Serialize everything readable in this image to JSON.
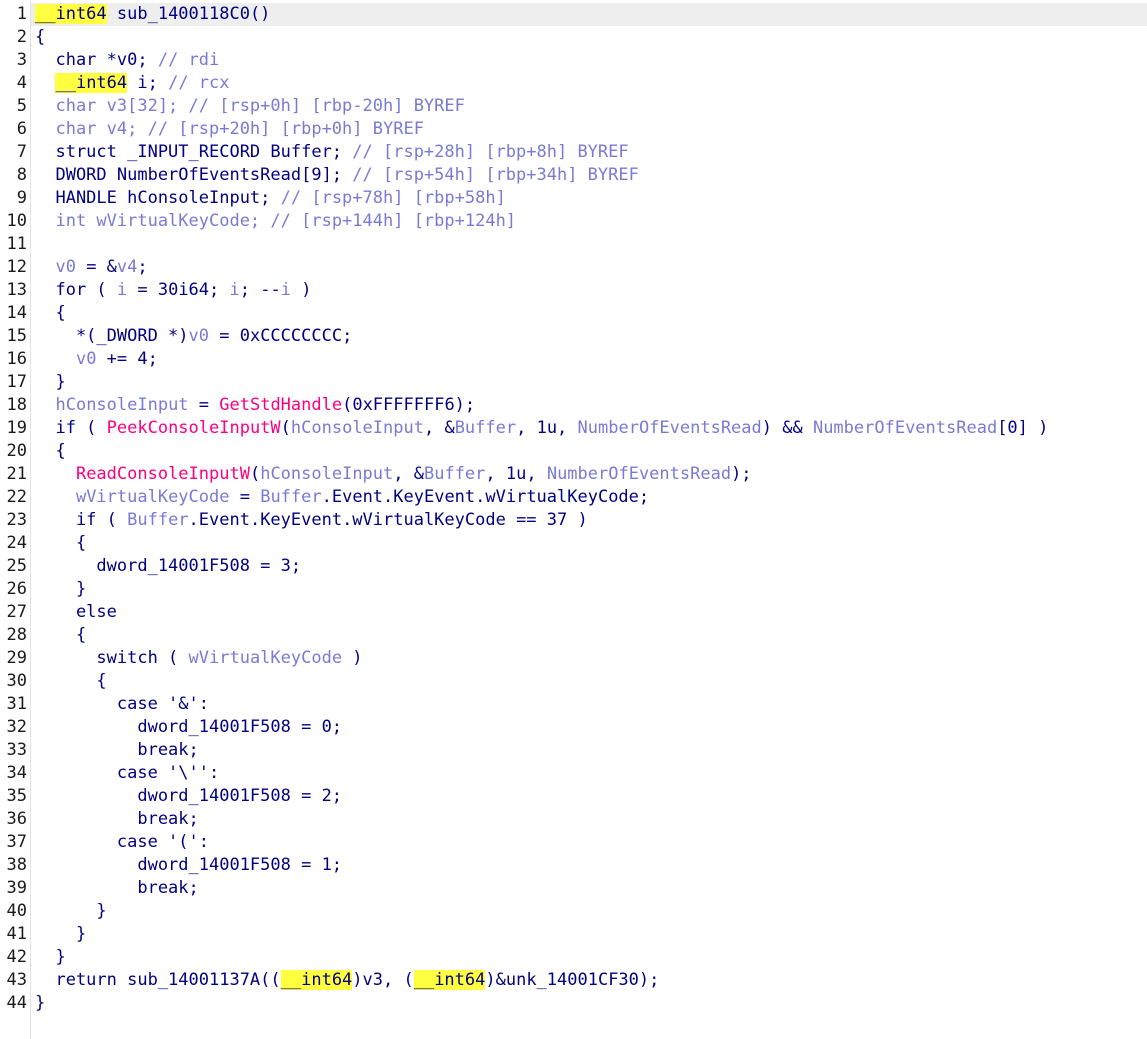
{
  "editor": {
    "lines": [
      {
        "num": "1",
        "tokens": [
          {
            "t": "__int64",
            "c": "hl"
          },
          {
            "t": " sub_1400118C0()",
            "c": "kw"
          }
        ]
      },
      {
        "num": "2",
        "tokens": [
          {
            "t": "{",
            "c": "kw"
          }
        ]
      },
      {
        "num": "3",
        "tokens": [
          {
            "t": "  char *v0; ",
            "c": "kw"
          },
          {
            "t": "// rdi",
            "c": "cmt"
          }
        ]
      },
      {
        "num": "4",
        "tokens": [
          {
            "t": "  ",
            "c": "kw"
          },
          {
            "t": "__int64",
            "c": "hl"
          },
          {
            "t": " i; ",
            "c": "kw"
          },
          {
            "t": "// rcx",
            "c": "cmt"
          }
        ]
      },
      {
        "num": "5",
        "tokens": [
          {
            "t": "  char v3[32]; // [rsp+0h] [rbp-20h] BYREF",
            "c": "cmt"
          }
        ]
      },
      {
        "num": "6",
        "tokens": [
          {
            "t": "  char v4; // [rsp+20h] [rbp+0h] BYREF",
            "c": "cmt"
          }
        ]
      },
      {
        "num": "7",
        "tokens": [
          {
            "t": "  struct _INPUT_RECORD Buffer; ",
            "c": "kw"
          },
          {
            "t": "// [rsp+28h] [rbp+8h] BYREF",
            "c": "cmt"
          }
        ]
      },
      {
        "num": "8",
        "tokens": [
          {
            "t": "  DWORD NumberOfEventsRead[9]; ",
            "c": "kw"
          },
          {
            "t": "// [rsp+54h] [rbp+34h] BYREF",
            "c": "cmt"
          }
        ]
      },
      {
        "num": "9",
        "tokens": [
          {
            "t": "  HANDLE hConsoleInput; ",
            "c": "kw"
          },
          {
            "t": "// [rsp+78h] [rbp+58h]",
            "c": "cmt"
          }
        ]
      },
      {
        "num": "10",
        "tokens": [
          {
            "t": "  int wVirtualKeyCode; // ",
            "c": "cmt"
          },
          {
            "t": "[rsp+144h] [rbp+124h]",
            "c": "cmt"
          }
        ]
      },
      {
        "num": "11",
        "tokens": []
      },
      {
        "num": "12",
        "tokens": [
          {
            "t": "  ",
            "c": "kw"
          },
          {
            "t": "v0",
            "c": "var"
          },
          {
            "t": " = &",
            "c": "kw"
          },
          {
            "t": "v4",
            "c": "var"
          },
          {
            "t": ";",
            "c": "kw"
          }
        ]
      },
      {
        "num": "13",
        "tokens": [
          {
            "t": "  for ( ",
            "c": "kw"
          },
          {
            "t": "i",
            "c": "var"
          },
          {
            "t": " = 30i64; ",
            "c": "kw"
          },
          {
            "t": "i",
            "c": "var"
          },
          {
            "t": "; --",
            "c": "kw"
          },
          {
            "t": "i",
            "c": "var"
          },
          {
            "t": " )",
            "c": "kw"
          }
        ]
      },
      {
        "num": "14",
        "tokens": [
          {
            "t": "  {",
            "c": "kw"
          }
        ]
      },
      {
        "num": "15",
        "tokens": [
          {
            "t": "    *(_DWORD *)",
            "c": "kw"
          },
          {
            "t": "v0",
            "c": "var"
          },
          {
            "t": " = 0xCCCCCCCC;",
            "c": "kw"
          }
        ]
      },
      {
        "num": "16",
        "tokens": [
          {
            "t": "    ",
            "c": "kw"
          },
          {
            "t": "v0",
            "c": "var"
          },
          {
            "t": " += 4;",
            "c": "kw"
          }
        ]
      },
      {
        "num": "17",
        "tokens": [
          {
            "t": "  }",
            "c": "kw"
          }
        ]
      },
      {
        "num": "18",
        "tokens": [
          {
            "t": "  ",
            "c": "kw"
          },
          {
            "t": "hConsoleInput",
            "c": "var"
          },
          {
            "t": " = ",
            "c": "kw"
          },
          {
            "t": "GetStdHandle",
            "c": "fn"
          },
          {
            "t": "(0xFFFFFFF6);",
            "c": "kw"
          }
        ]
      },
      {
        "num": "19",
        "tokens": [
          {
            "t": "  if ( ",
            "c": "kw"
          },
          {
            "t": "PeekConsoleInputW",
            "c": "fn"
          },
          {
            "t": "(",
            "c": "kw"
          },
          {
            "t": "hConsoleInput",
            "c": "var"
          },
          {
            "t": ", &",
            "c": "kw"
          },
          {
            "t": "Buffer",
            "c": "var"
          },
          {
            "t": ", 1u, ",
            "c": "kw"
          },
          {
            "t": "NumberOfEventsRead",
            "c": "var"
          },
          {
            "t": ") && ",
            "c": "kw"
          },
          {
            "t": "NumberOfEventsRead",
            "c": "var"
          },
          {
            "t": "[0] )",
            "c": "kw"
          }
        ]
      },
      {
        "num": "20",
        "tokens": [
          {
            "t": "  {",
            "c": "kw"
          }
        ]
      },
      {
        "num": "21",
        "tokens": [
          {
            "t": "    ",
            "c": "kw"
          },
          {
            "t": "ReadConsoleInputW",
            "c": "fn"
          },
          {
            "t": "(",
            "c": "kw"
          },
          {
            "t": "hConsoleInput",
            "c": "var"
          },
          {
            "t": ", &",
            "c": "kw"
          },
          {
            "t": "Buffer",
            "c": "var"
          },
          {
            "t": ", 1u, ",
            "c": "kw"
          },
          {
            "t": "NumberOfEventsRead",
            "c": "var"
          },
          {
            "t": ");",
            "c": "kw"
          }
        ]
      },
      {
        "num": "22",
        "tokens": [
          {
            "t": "    ",
            "c": "kw"
          },
          {
            "t": "wVirtualKeyCode",
            "c": "var"
          },
          {
            "t": " = ",
            "c": "kw"
          },
          {
            "t": "Buffer",
            "c": "var"
          },
          {
            "t": ".Event.KeyEvent.wVirtualKeyCode;",
            "c": "kw"
          }
        ]
      },
      {
        "num": "23",
        "tokens": [
          {
            "t": "    if ( ",
            "c": "kw"
          },
          {
            "t": "Buffer",
            "c": "var"
          },
          {
            "t": ".Event.KeyEvent.wVirtualKeyCode == 37 )",
            "c": "kw"
          }
        ]
      },
      {
        "num": "24",
        "tokens": [
          {
            "t": "    {",
            "c": "kw"
          }
        ]
      },
      {
        "num": "25",
        "tokens": [
          {
            "t": "      dword_14001F508 = 3;",
            "c": "kw"
          }
        ]
      },
      {
        "num": "26",
        "tokens": [
          {
            "t": "    }",
            "c": "kw"
          }
        ]
      },
      {
        "num": "27",
        "tokens": [
          {
            "t": "    else",
            "c": "kw"
          }
        ]
      },
      {
        "num": "28",
        "tokens": [
          {
            "t": "    {",
            "c": "kw"
          }
        ]
      },
      {
        "num": "29",
        "tokens": [
          {
            "t": "      switch ( ",
            "c": "kw"
          },
          {
            "t": "wVirtualKeyCode",
            "c": "var"
          },
          {
            "t": " )",
            "c": "kw"
          }
        ]
      },
      {
        "num": "30",
        "tokens": [
          {
            "t": "      {",
            "c": "kw"
          }
        ]
      },
      {
        "num": "31",
        "tokens": [
          {
            "t": "        case '&':",
            "c": "kw"
          }
        ]
      },
      {
        "num": "32",
        "tokens": [
          {
            "t": "          dword_14001F508 = 0;",
            "c": "kw"
          }
        ]
      },
      {
        "num": "33",
        "tokens": [
          {
            "t": "          break;",
            "c": "kw"
          }
        ]
      },
      {
        "num": "34",
        "tokens": [
          {
            "t": "        case '\\'':",
            "c": "kw"
          }
        ]
      },
      {
        "num": "35",
        "tokens": [
          {
            "t": "          dword_14001F508 = 2;",
            "c": "kw"
          }
        ]
      },
      {
        "num": "36",
        "tokens": [
          {
            "t": "          break;",
            "c": "kw"
          }
        ]
      },
      {
        "num": "37",
        "tokens": [
          {
            "t": "        case '(':",
            "c": "kw"
          }
        ]
      },
      {
        "num": "38",
        "tokens": [
          {
            "t": "          dword_14001F508 = 1;",
            "c": "kw"
          }
        ]
      },
      {
        "num": "39",
        "tokens": [
          {
            "t": "          break;",
            "c": "kw"
          }
        ]
      },
      {
        "num": "40",
        "tokens": [
          {
            "t": "      }",
            "c": "kw"
          }
        ]
      },
      {
        "num": "41",
        "tokens": [
          {
            "t": "    }",
            "c": "kw"
          }
        ]
      },
      {
        "num": "42",
        "tokens": [
          {
            "t": "  }",
            "c": "kw"
          }
        ]
      },
      {
        "num": "43",
        "tokens": [
          {
            "t": "  return sub_14001137A((",
            "c": "kw"
          },
          {
            "t": "__int64",
            "c": "hl"
          },
          {
            "t": ")v3, (",
            "c": "kw"
          },
          {
            "t": "__int64",
            "c": "hl"
          },
          {
            "t": ")&unk_14001CF30);",
            "c": "kw"
          }
        ]
      },
      {
        "num": "44",
        "tokens": [
          {
            "t": "}",
            "c": "kw"
          }
        ]
      }
    ]
  }
}
